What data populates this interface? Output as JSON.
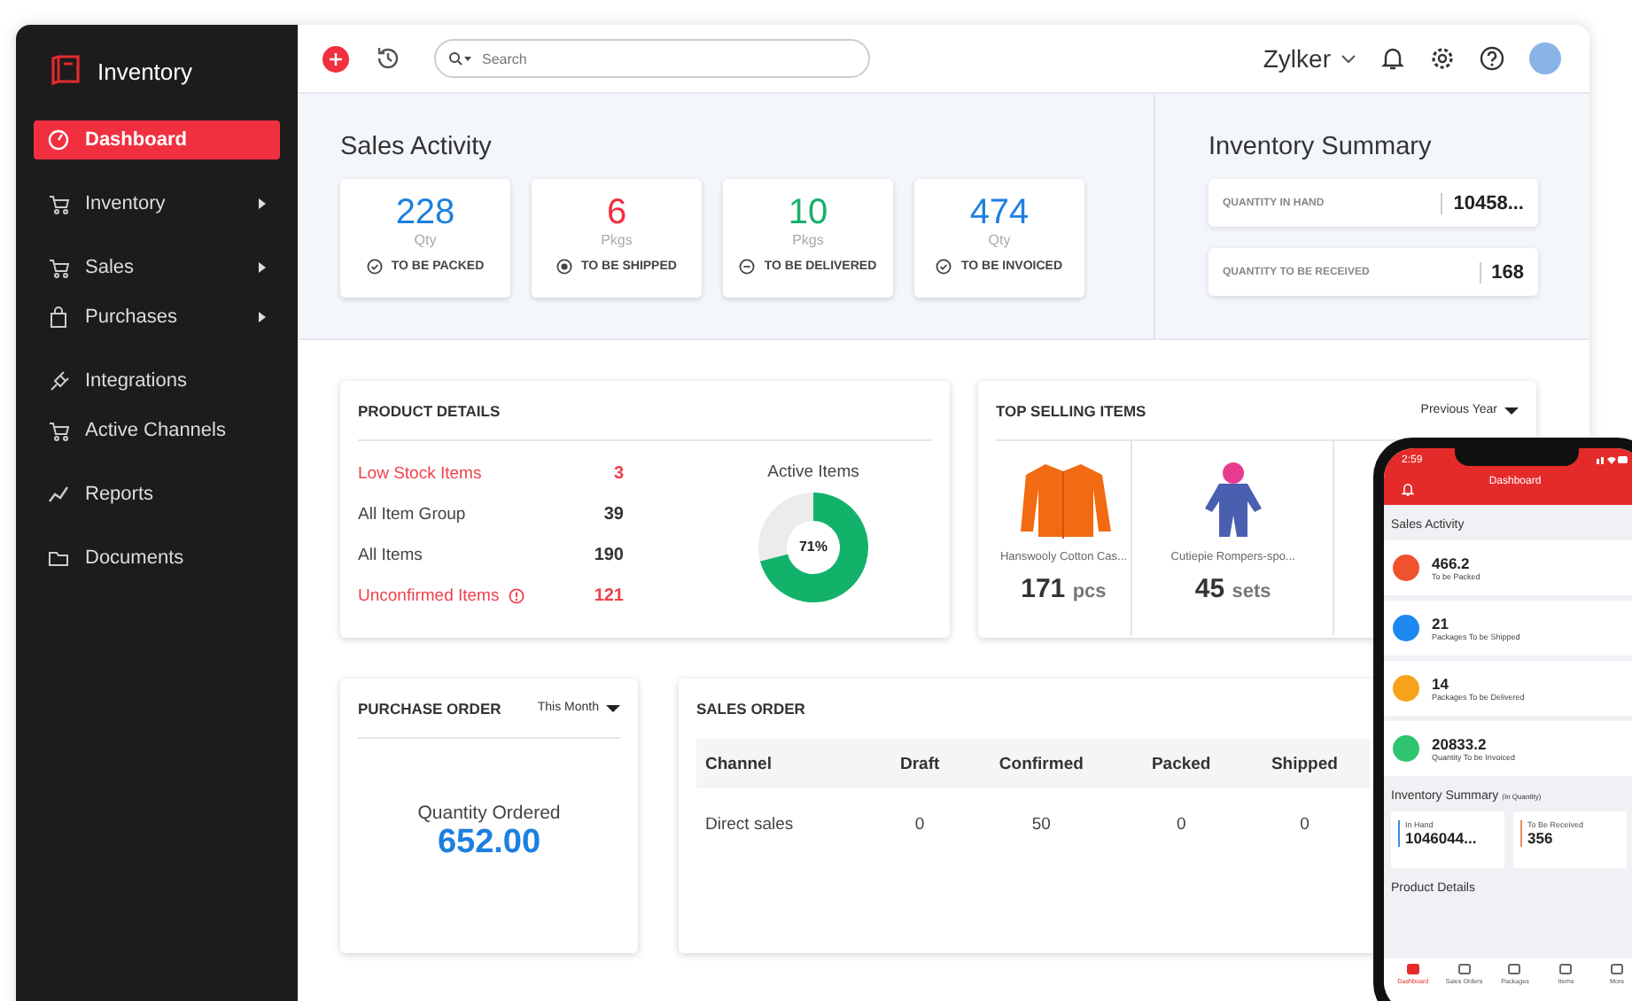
{
  "sidebar": {
    "app_name": "Inventory",
    "groups": [
      [
        {
          "label": "Dashboard",
          "kind": "gauge",
          "submenu": false,
          "selected": true
        }
      ],
      [
        {
          "label": "Inventory",
          "kind": "cart",
          "submenu": true,
          "selected": false
        }
      ],
      [
        {
          "label": "Sales",
          "kind": "cart",
          "submenu": true,
          "selected": false
        },
        {
          "label": "Purchases",
          "kind": "bag",
          "submenu": true,
          "selected": false
        }
      ],
      [
        {
          "label": "Integrations",
          "kind": "plug",
          "submenu": false,
          "selected": false
        },
        {
          "label": "Active Channels",
          "kind": "cart",
          "submenu": false,
          "selected": false
        }
      ],
      [
        {
          "label": "Reports",
          "kind": "chart",
          "submenu": false,
          "selected": false
        }
      ],
      [
        {
          "label": "Documents",
          "kind": "folder",
          "submenu": false,
          "selected": false
        }
      ]
    ]
  },
  "topbar": {
    "search": {
      "placeholder": "Search"
    },
    "organization": "Zylker"
  },
  "sales_activity": {
    "title": "Sales Activity",
    "cards": [
      {
        "value": "228",
        "unit": "Qty",
        "label": "TO BE PACKED",
        "color": "#1d7fe0",
        "kind": "check"
      },
      {
        "value": "6",
        "unit": "Pkgs",
        "label": "TO BE SHIPPED",
        "color": "#f0303f",
        "kind": "dot"
      },
      {
        "value": "10",
        "unit": "Pkgs",
        "label": "TO BE DELIVERED",
        "color": "#16b06b",
        "kind": "minus"
      },
      {
        "value": "474",
        "unit": "Qty",
        "label": "TO BE INVOICED",
        "color": "#1d7fe0",
        "kind": "check"
      }
    ]
  },
  "inventory_summary": {
    "title": "Inventory Summary",
    "rows": [
      {
        "label": "QUANTITY IN HAND",
        "value": "10458..."
      },
      {
        "label": "QUANTITY TO BE RECEIVED",
        "value": "168"
      }
    ]
  },
  "product_details": {
    "title": "PRODUCT DETAILS",
    "rows": [
      {
        "label": "Low Stock Items",
        "value": "3",
        "alert": true,
        "info_icon": false
      },
      {
        "label": "All Item Group",
        "value": "39",
        "alert": false,
        "info_icon": false
      },
      {
        "label": "All Items",
        "value": "190",
        "alert": false,
        "info_icon": false
      },
      {
        "label": "Unconfirmed Items",
        "value": "121",
        "alert": true,
        "info_icon": true
      }
    ],
    "active_items": {
      "center_label": "71%",
      "chart_data": {
        "type": "donut",
        "title": "Active Items",
        "values": [
          71,
          29
        ]
      }
    }
  },
  "top_selling": {
    "title": "TOP SELLING ITEMS",
    "period": "Previous Year",
    "items": [
      {
        "name": "Hanswooly Cotton Cas...",
        "quantity": "171",
        "unit": "pcs",
        "kind": "sweater"
      },
      {
        "name": "Cutiepie Rompers-spo...",
        "quantity": "45",
        "unit": "sets",
        "kind": "romper"
      }
    ]
  },
  "purchase_order": {
    "title": "PURCHASE ORDER",
    "period": "This Month",
    "label": "Quantity Ordered",
    "value": "652.00"
  },
  "sales_order": {
    "title": "SALES ORDER",
    "columns": [
      "Channel",
      "Draft",
      "Confirmed",
      "Packed",
      "Shipped"
    ],
    "rows": [
      [
        "Direct sales",
        "0",
        "50",
        "0",
        "0"
      ]
    ]
  },
  "phone": {
    "time": "2:59",
    "title": "Dashboard",
    "sales_activity_title": "Sales Activity",
    "activity": [
      {
        "value": "466.2",
        "label": "To be Packed",
        "color": "#f0522e"
      },
      {
        "value": "21",
        "label": "Packages To be Shipped",
        "color": "#1e88f0"
      },
      {
        "value": "14",
        "label": "Packages To be Delivered",
        "color": "#f7a21b"
      },
      {
        "value": "20833.2",
        "label": "Quantity To be Invoiced",
        "color": "#2fc46f"
      }
    ],
    "inventory_title": "Inventory Summary",
    "inventory_note": "(In Quantity)",
    "inventory": [
      {
        "label": "In Hand",
        "value": "1046044...",
        "color": "#3b8de0"
      },
      {
        "label": "To Be Received",
        "value": "356",
        "color": "#f08a5d"
      }
    ],
    "product_details_title": "Product Details",
    "tabs": [
      {
        "label": "Dashboard",
        "selected": true
      },
      {
        "label": "Sales Orders",
        "selected": false
      },
      {
        "label": "Packages",
        "selected": false
      },
      {
        "label": "Items",
        "selected": false
      },
      {
        "label": "More",
        "selected": false
      }
    ]
  }
}
